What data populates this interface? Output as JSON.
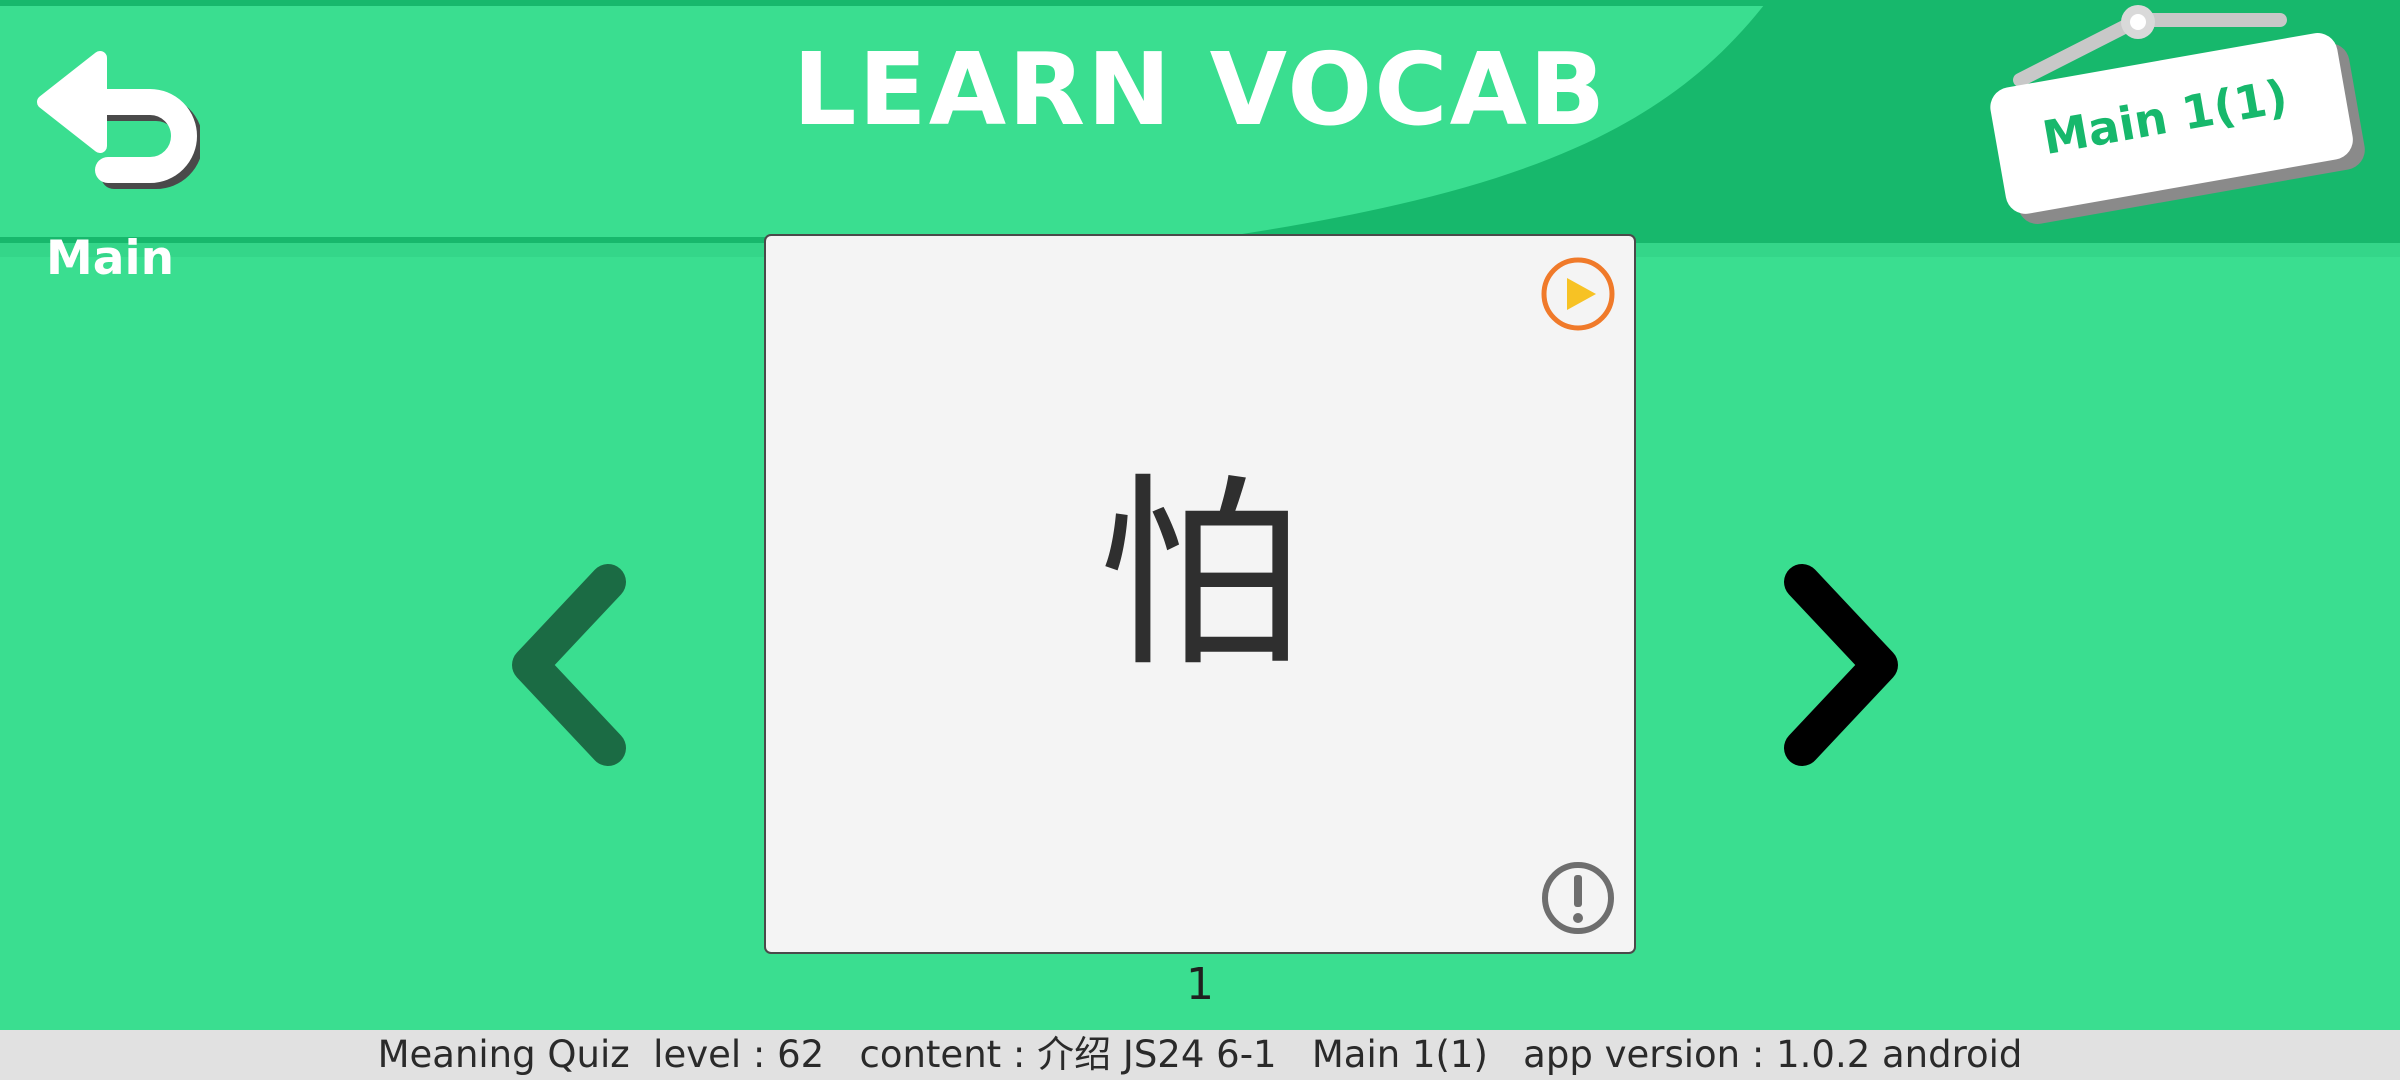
{
  "header": {
    "title": "LEARN VOCAB",
    "back_label": "Main",
    "sign_label": "Main 1(1)"
  },
  "card": {
    "character": "怕",
    "page_number": "1"
  },
  "status_bar": {
    "text": "Meaning Quiz  level : 62   content : 介绍 JS24 6-1   Main 1(1)   app version : 1.0.2 android"
  },
  "icons": {
    "back": "undo-arrow-icon",
    "play": "play-audio-icon",
    "info": "exclamation-info-icon",
    "prev": "chevron-left-icon",
    "next": "chevron-right-icon"
  },
  "colors": {
    "background": "#3ade90",
    "header_dark": "#17b86c",
    "card": "#f4f4f4",
    "play_ring": "#f07a2a",
    "play_fill": "#f7c224",
    "prev_chevron": "#1b6b44",
    "next_chevron": "#000000"
  }
}
